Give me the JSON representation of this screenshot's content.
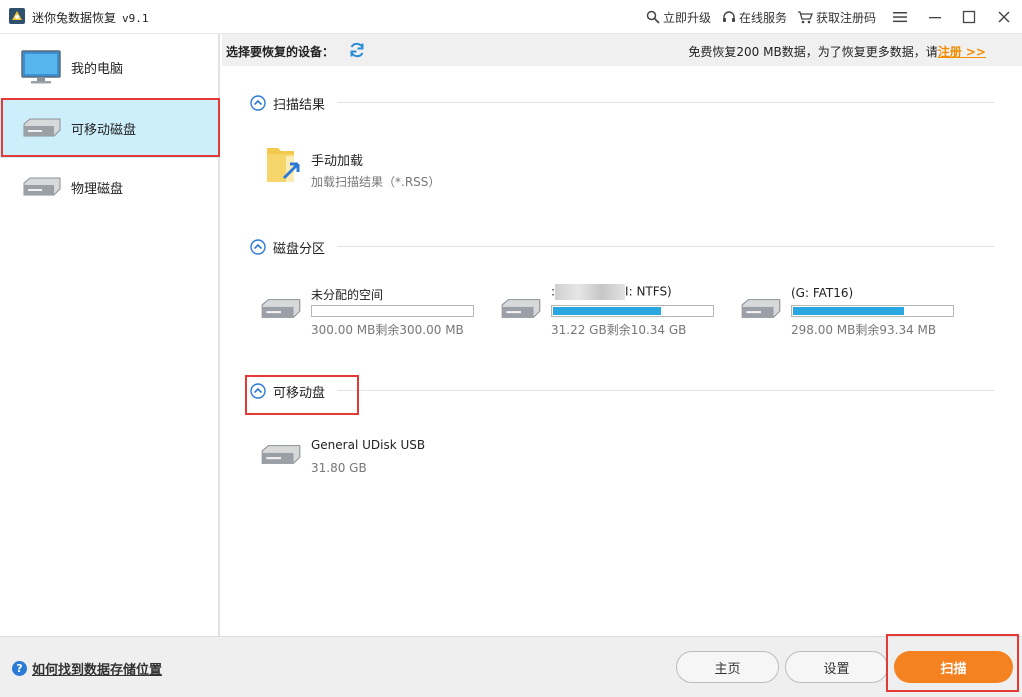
{
  "window": {
    "title": "迷你兔数据恢复",
    "version": "v9.1",
    "links": [
      {
        "label": "立即升级",
        "icon": "magnifier-key-icon"
      },
      {
        "label": "在线服务",
        "icon": "headset-icon"
      },
      {
        "label": "获取注册码",
        "icon": "cart-icon"
      }
    ],
    "controls": [
      "menu-icon",
      "minimize-icon",
      "maximize-icon",
      "close-icon"
    ]
  },
  "sidebar": {
    "items": [
      {
        "label": "我的电脑",
        "icon": "monitor-icon",
        "active": false
      },
      {
        "label": "可移动磁盘",
        "icon": "drive-icon",
        "active": true
      },
      {
        "label": "物理磁盘",
        "icon": "drive-icon",
        "active": false
      }
    ]
  },
  "topbar": {
    "select_label": "选择要恢复的设备：",
    "promo_text": "免费恢复200 MB数据，为了恢复更多数据，请",
    "promo_link": "注册 >>"
  },
  "sections": {
    "scan_results": {
      "title": "扫描结果",
      "item_name": "手动加载",
      "item_desc": "加载扫描结果（*.RSS）"
    },
    "partitions": {
      "title": "磁盘分区",
      "items": [
        {
          "name": "未分配的空间",
          "usage": "300.00 MB剩余300.00 MB",
          "fill": 0.0
        },
        {
          "name_prefix": ":",
          "name": "I: NTFS)",
          "usage": "31.22 GB剩余10.34 GB",
          "fill": 0.67
        },
        {
          "name": "(G: FAT16)",
          "usage": "298.00 MB剩余93.34 MB",
          "fill": 0.69
        }
      ]
    },
    "removable": {
      "title": "可移动盘",
      "items": [
        {
          "name": "General UDisk USB",
          "size": "31.80 GB"
        }
      ]
    }
  },
  "footer": {
    "help_text": "如何找到数据存储位置",
    "home_label": "主页",
    "settings_label": "设置",
    "scan_label": "扫描"
  },
  "colors": {
    "accent_orange": "#f58220",
    "progress_blue": "#2aa6e0",
    "selected_bg": "#cdeffb",
    "highlight_red": "#e53935"
  }
}
